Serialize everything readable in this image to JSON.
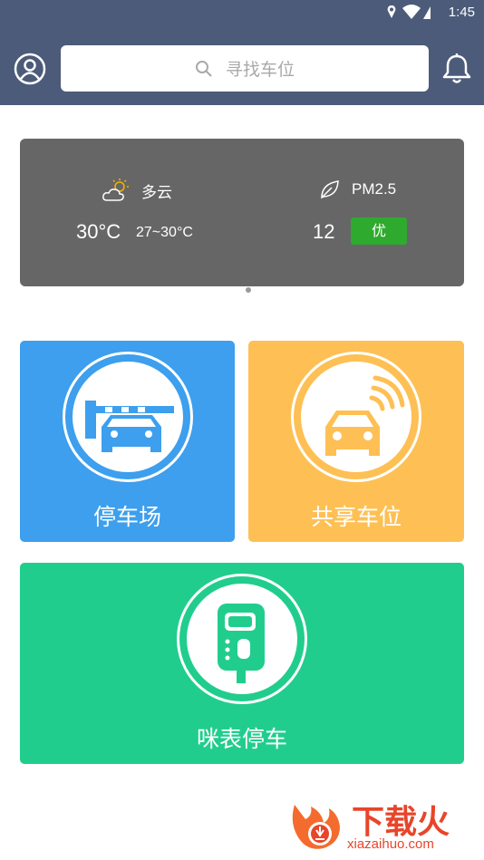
{
  "status": {
    "time": "1:45"
  },
  "search": {
    "placeholder": "寻找车位"
  },
  "weather": {
    "condition": "多云",
    "temperature": "30°C",
    "range": "27~30°C",
    "pm_label": "PM2.5",
    "pm_value": "12",
    "pm_quality": "优"
  },
  "tiles": [
    {
      "label": "停车场",
      "color": "#3d9fed"
    },
    {
      "label": "共享车位",
      "color": "#fec054"
    },
    {
      "label": "咪表停车",
      "color": "#21cd8d"
    }
  ],
  "watermark": {
    "brand": "下载火",
    "url": "xiazaihuo.com"
  },
  "colors": {
    "header": "#4c5b79",
    "weather_bg": "#666666",
    "badge_green": "#2eaa2e"
  }
}
